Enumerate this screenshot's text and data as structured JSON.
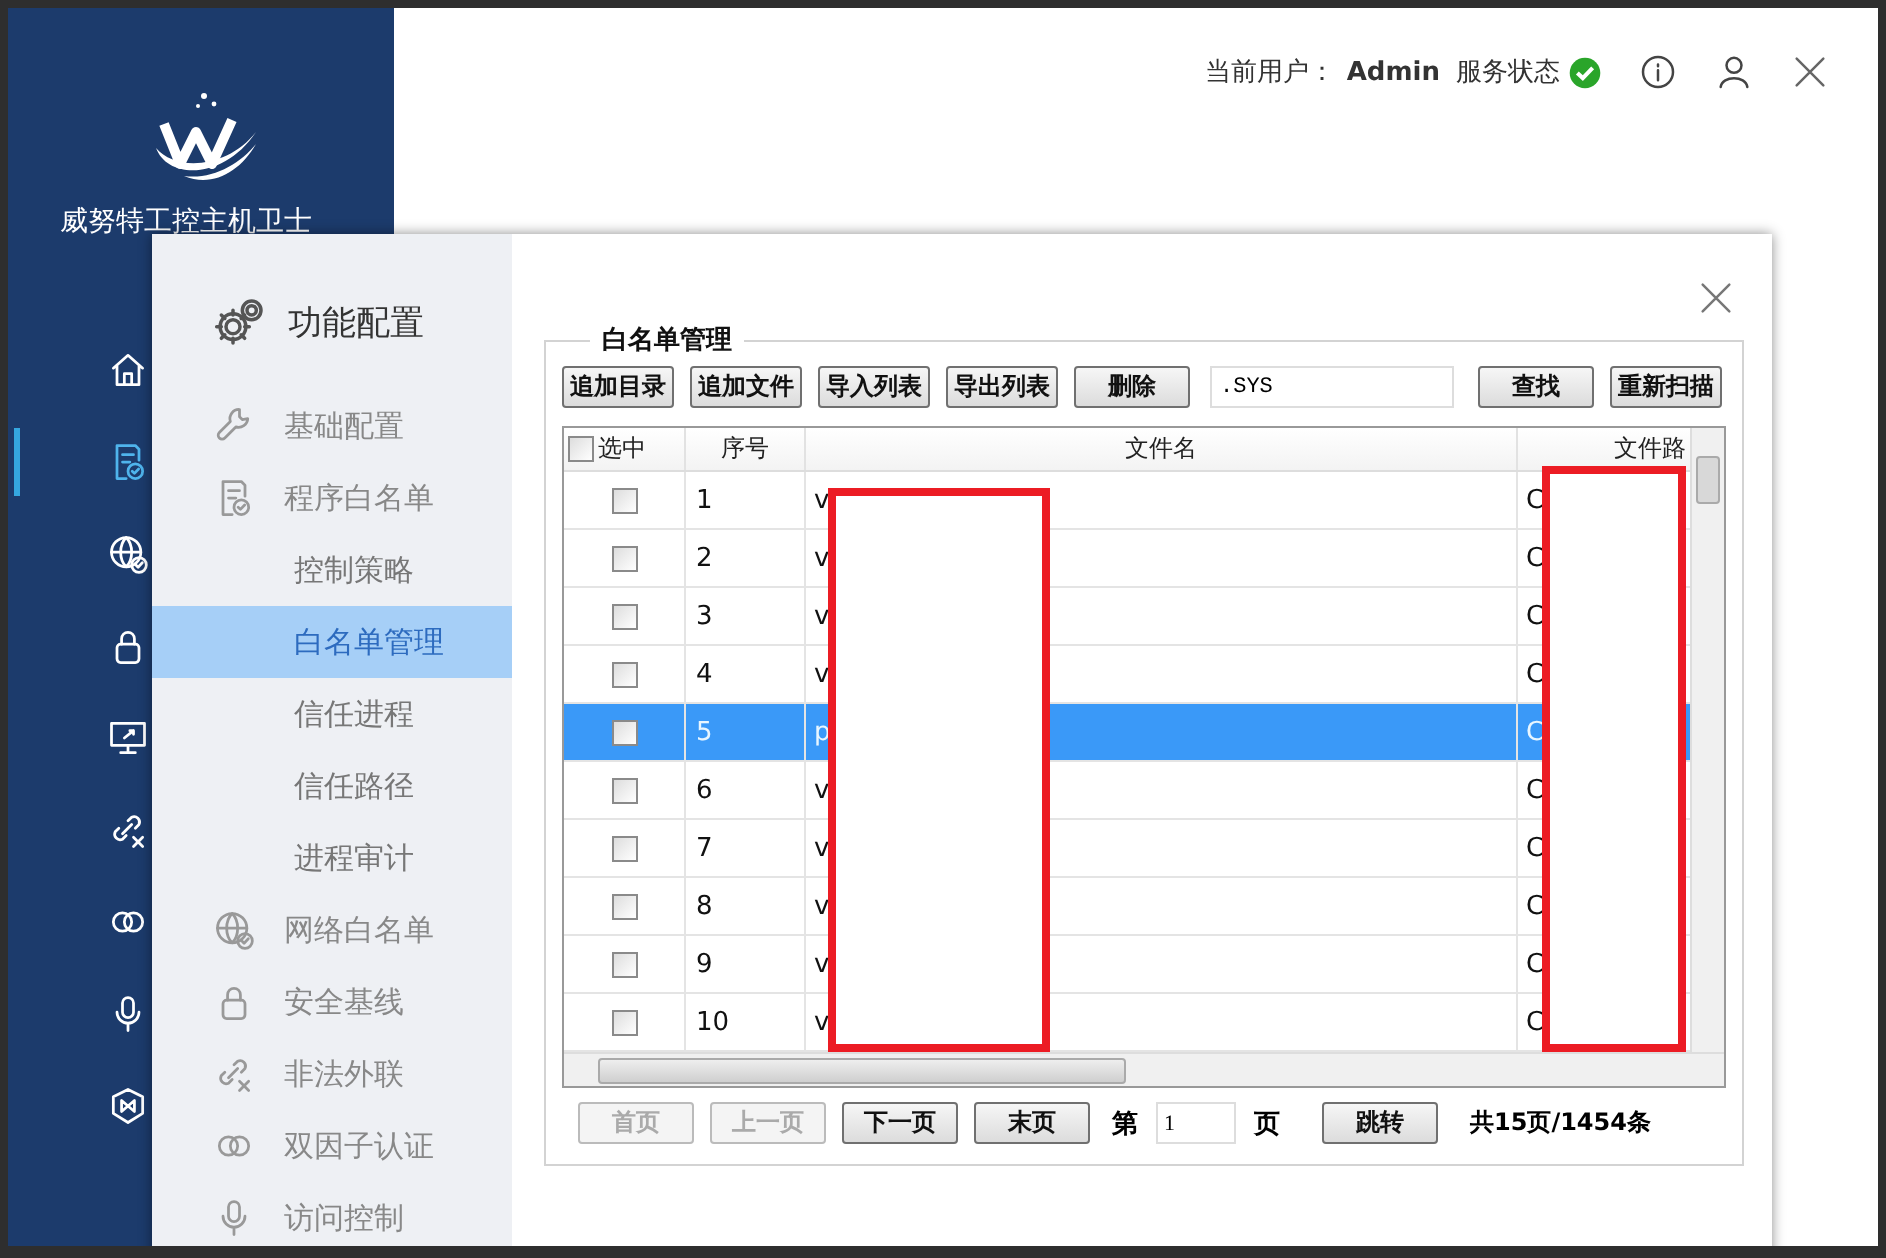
{
  "app": {
    "title": "威努特工控主机卫士"
  },
  "nav": [
    {
      "selected": false
    },
    {
      "selected": true
    },
    {
      "selected": false
    },
    {
      "selected": false
    },
    {
      "selected": false
    },
    {
      "selected": false
    },
    {
      "selected": false
    },
    {
      "selected": false
    },
    {
      "selected": false
    }
  ],
  "header": {
    "user_label": "当前用户：",
    "user": "Admin",
    "status_label": "服务状态",
    "status_ok": true
  },
  "dialog": {
    "title": "功能配置",
    "menu": [
      {
        "label": "基础配置",
        "selected": false
      },
      {
        "label": "程序白名单",
        "selected": false,
        "children": [
          {
            "label": "控制策略",
            "selected": false
          },
          {
            "label": "白名单管理",
            "selected": true
          },
          {
            "label": "信任进程",
            "selected": false
          },
          {
            "label": "信任路径",
            "selected": false
          },
          {
            "label": "进程审计",
            "selected": false
          }
        ]
      },
      {
        "label": "网络白名单",
        "selected": false
      },
      {
        "label": "安全基线",
        "selected": false
      },
      {
        "label": "非法外联",
        "selected": false
      },
      {
        "label": "双因子认证",
        "selected": false
      },
      {
        "label": "访问控制",
        "selected": false
      }
    ],
    "section_title": "白名单管理",
    "toolbar": {
      "buttons_left": [
        "追加目录",
        "追加文件",
        "导入列表",
        "导出列表",
        "删除"
      ],
      "search": ".SYS",
      "buttons_right": [
        "查找",
        "重新扫描"
      ]
    },
    "table": {
      "columns": [
        "选中",
        "序号",
        "文件名",
        "文件路"
      ],
      "all_checked": false,
      "rows": [
        {
          "checked": false,
          "index": "1",
          "file_name": "v",
          "file_path": "C",
          "selected": false
        },
        {
          "checked": false,
          "index": "2",
          "file_name": "v",
          "file_path": "C",
          "selected": false
        },
        {
          "checked": false,
          "index": "3",
          "file_name": "v",
          "file_path": "C",
          "selected": false
        },
        {
          "checked": false,
          "index": "4",
          "file_name": "v",
          "file_path": "C",
          "selected": false
        },
        {
          "checked": false,
          "index": "5",
          "file_name": "p",
          "file_path": "C",
          "selected": true
        },
        {
          "checked": false,
          "index": "6",
          "file_name": "v",
          "file_path": "C",
          "selected": false
        },
        {
          "checked": false,
          "index": "7",
          "file_name": "v",
          "file_path": "C",
          "selected": false
        },
        {
          "checked": false,
          "index": "8",
          "file_name": "v",
          "file_path": "C",
          "selected": false
        },
        {
          "checked": false,
          "index": "9",
          "file_name": "v",
          "file_path": "C",
          "selected": false
        },
        {
          "checked": false,
          "index": "10",
          "file_name": "v",
          "file_path": "C",
          "selected": false
        }
      ]
    },
    "pager": {
      "buttons": [
        {
          "label": "首页",
          "disabled": true
        },
        {
          "label": "上一页",
          "disabled": true
        },
        {
          "label": "下一页",
          "disabled": false
        },
        {
          "label": "末页",
          "disabled": false
        }
      ],
      "page_prefix": "第",
      "page": "1",
      "page_suffix": "页",
      "jump": "跳转",
      "summary": "共15页/1454条"
    }
  }
}
